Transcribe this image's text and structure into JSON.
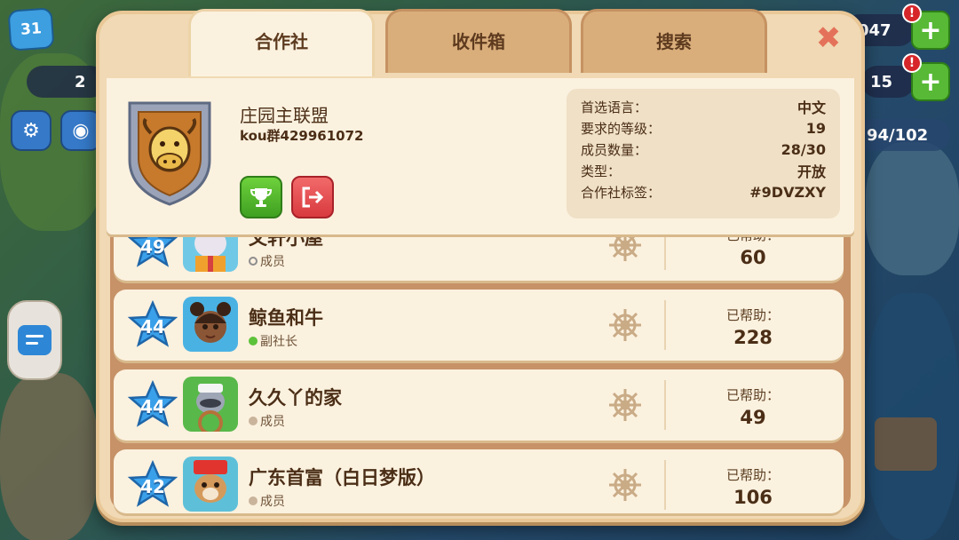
{
  "hud": {
    "level": "31",
    "pill_left": "2",
    "coins": "047",
    "gems": "15",
    "capacity": "94/102",
    "alert": "!"
  },
  "tabs": [
    {
      "label": "合作社",
      "active": true
    },
    {
      "label": "收件箱",
      "active": false
    },
    {
      "label": "搜索",
      "active": false
    }
  ],
  "close_label": "✖",
  "club": {
    "name": "庄园主联盟",
    "subtitle": "kou群429961072",
    "info": [
      {
        "key": "首选语言：",
        "value": "中文"
      },
      {
        "key": "要求的等级：",
        "value": "19"
      },
      {
        "key": "成员数量：",
        "value": "28/30"
      },
      {
        "key": "类型：",
        "value": "开放"
      },
      {
        "key": "合作社标签：",
        "value": "#9DVZXY"
      }
    ]
  },
  "members": [
    {
      "level": "49",
      "name": "文轩小屋",
      "role": "成员",
      "role_dot": "#8d8d8d",
      "helped_label": "已帮助：",
      "helped": "60",
      "avatar": "bunny-avatar"
    },
    {
      "level": "44",
      "name": "鲸鱼和牛",
      "role": "副社长",
      "role_dot": "#5cc23a",
      "helped_label": "已帮助：",
      "helped": "228",
      "avatar": "girl-avatar"
    },
    {
      "level": "44",
      "name": "久久丫的家",
      "role": "成员",
      "role_dot": "#c9b49b",
      "helped_label": "已帮助：",
      "helped": "49",
      "avatar": "raccoon-captain-avatar"
    },
    {
      "level": "42",
      "name": "广东首富（白日梦版）",
      "role": "成员",
      "role_dot": "#c9b49b",
      "helped_label": "已帮助：",
      "helped": "106",
      "avatar": "puppy-avatar"
    }
  ],
  "colors": {
    "panel": "#f0d9b4",
    "card": "#fbf1df",
    "accent_green": "#4fb22a",
    "accent_red": "#df4347",
    "star_blue": "#3aa0ea"
  }
}
